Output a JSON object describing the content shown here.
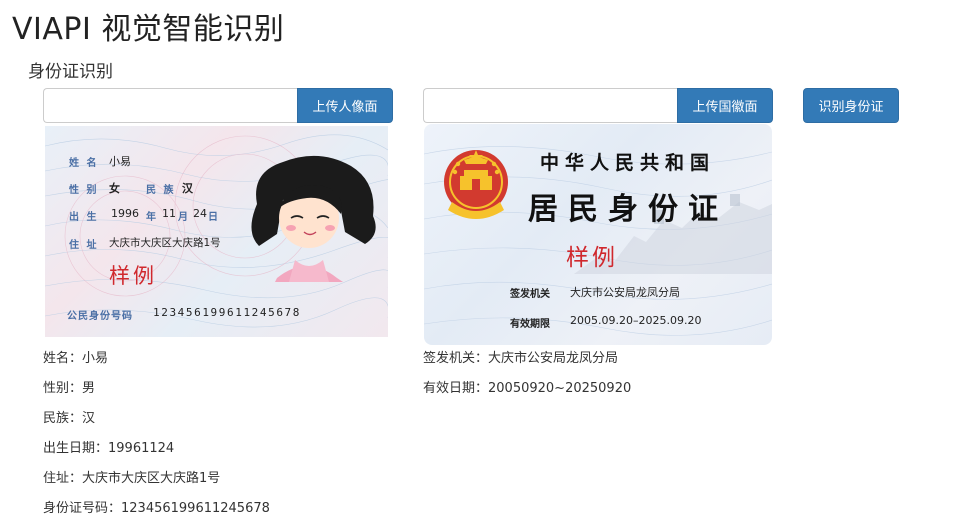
{
  "app": {
    "title": "VIAPI 视觉智能识别"
  },
  "section": {
    "title": "身份证识别"
  },
  "upload": {
    "front_button": "上传人像面",
    "back_button": "上传国徽面",
    "recognize_button": "识别身份证"
  },
  "card_front": {
    "name_label": "姓 名",
    "name": "小易",
    "sex_label": "性 别",
    "sex": "女",
    "ethnicity_label": "民 族",
    "ethnicity": "汉",
    "birth_label": "出 生",
    "birth_year": "1996",
    "year_char": "年",
    "birth_month": "11",
    "month_char": "月",
    "birth_day": "24",
    "day_char": "日",
    "address_label": "住 址",
    "address": "大庆市大庆区大庆路1号",
    "sample": "样例",
    "idnum_label": "公民身份号码",
    "idnum": "123456199611245678"
  },
  "card_back": {
    "country": "中华人民共和国",
    "document": "居民身份证",
    "sample": "样例",
    "authority_label": "签发机关",
    "authority": "大庆市公安局龙凤分局",
    "validity_label": "有效期限",
    "validity": "2005.09.20–2025.09.20"
  },
  "results_front": [
    {
      "label": "姓名：",
      "value": "小易"
    },
    {
      "label": "性别：",
      "value": "男"
    },
    {
      "label": "民族：",
      "value": "汉"
    },
    {
      "label": "出生日期：",
      "value": "19961124"
    },
    {
      "label": "住址：",
      "value": "大庆市大庆区大庆路1号"
    },
    {
      "label": "身份证号码：",
      "value": "123456199611245678"
    }
  ],
  "results_back": [
    {
      "label": "签发机关：",
      "value": "大庆市公安局龙凤分局"
    },
    {
      "label": "有效日期：",
      "value": "20050920~20250920"
    }
  ],
  "colors": {
    "primary": "#337ab7",
    "sample_red": "#d0282d",
    "emblem_red": "#c8161d",
    "emblem_gold": "#f6c22c"
  }
}
